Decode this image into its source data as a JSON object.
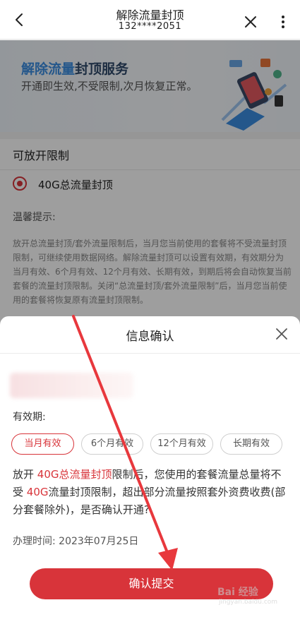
{
  "header": {
    "title": "解除流量封顶",
    "subtitle": "132****2051",
    "icons": [
      "chevron-left-icon",
      "close-icon",
      "more-vertical-icon"
    ]
  },
  "banner": {
    "title_blue": "解除流量",
    "title_dark": "封顶服务",
    "subtitle": "开通即生效,不受限制,次月恢复正常。"
  },
  "limits": {
    "section_title": "可放开限制",
    "option_label": "40G总流量封顶",
    "tip_title": "温馨提示:",
    "tip_body": "放开总流量封顶/套外流量限制后，当月您当前使用的套餐将不受流量封顶限制，可继续使用数据网络。解除流量封顶可以设置有效期，有效期分为当月有效、6个月有效、12个月有效、长期有效，到期后将会自动恢复当前套餐的流量封顶限制。关闭“总流量封顶/套外流量限制”后，当月您当前使用的套餐将恢复原有流量封顶限制。"
  },
  "dialog": {
    "title": "信息确认",
    "validity_label": "有效期:",
    "chips": [
      "当月有效",
      "6个月有效",
      "12个月有效",
      "长期有效"
    ],
    "selected_chip": "当月有效",
    "desc_part1": "放开 ",
    "desc_red1": "40G总流量封顶",
    "desc_part2": "限制后，您使用的套餐流量总量将不受 ",
    "desc_red2": "40G",
    "desc_part3": "流量封顶限制，超出部分流量按照套外资费收费(部分套餐除外)，是否确认开通?",
    "date_label": "办理时间:",
    "date_value": "2023年07月25日",
    "confirm_label": "确认提交"
  },
  "watermark": {
    "text": "Bai 经验",
    "url": "jingyan.baidu.com"
  },
  "colors": {
    "accent": "#d8343a",
    "banner_blue": "#3a8de0"
  }
}
